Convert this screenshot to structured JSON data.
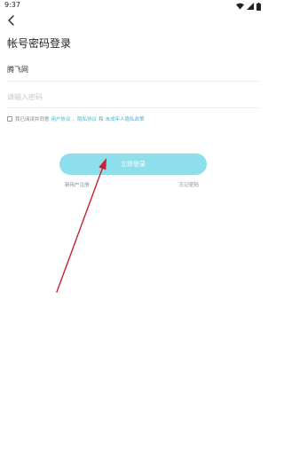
{
  "status_bar": {
    "time": "9:37",
    "icons": [
      "wifi-icon",
      "cellular-signal-icon",
      "battery-icon"
    ]
  },
  "header": {
    "back_icon": "back-arrow-icon",
    "title": "帐号密码登录"
  },
  "form": {
    "account_value": "腾飞网",
    "password_placeholder": "请输入密码",
    "agreement": {
      "prefix": "我已阅读并同意",
      "user_agreement": "用户协议",
      "separator": "、",
      "privacy_policy": "隐私协议",
      "and": "和",
      "minor_privacy": "未成年人隐私政策"
    },
    "login_button": "立即登录",
    "register_link": "新用户注册",
    "forgot_link": "忘记密码"
  },
  "colors": {
    "accent": "#40b7d2",
    "button_bg": "#8ddfec",
    "annotation_arrow": "#c8232c"
  }
}
